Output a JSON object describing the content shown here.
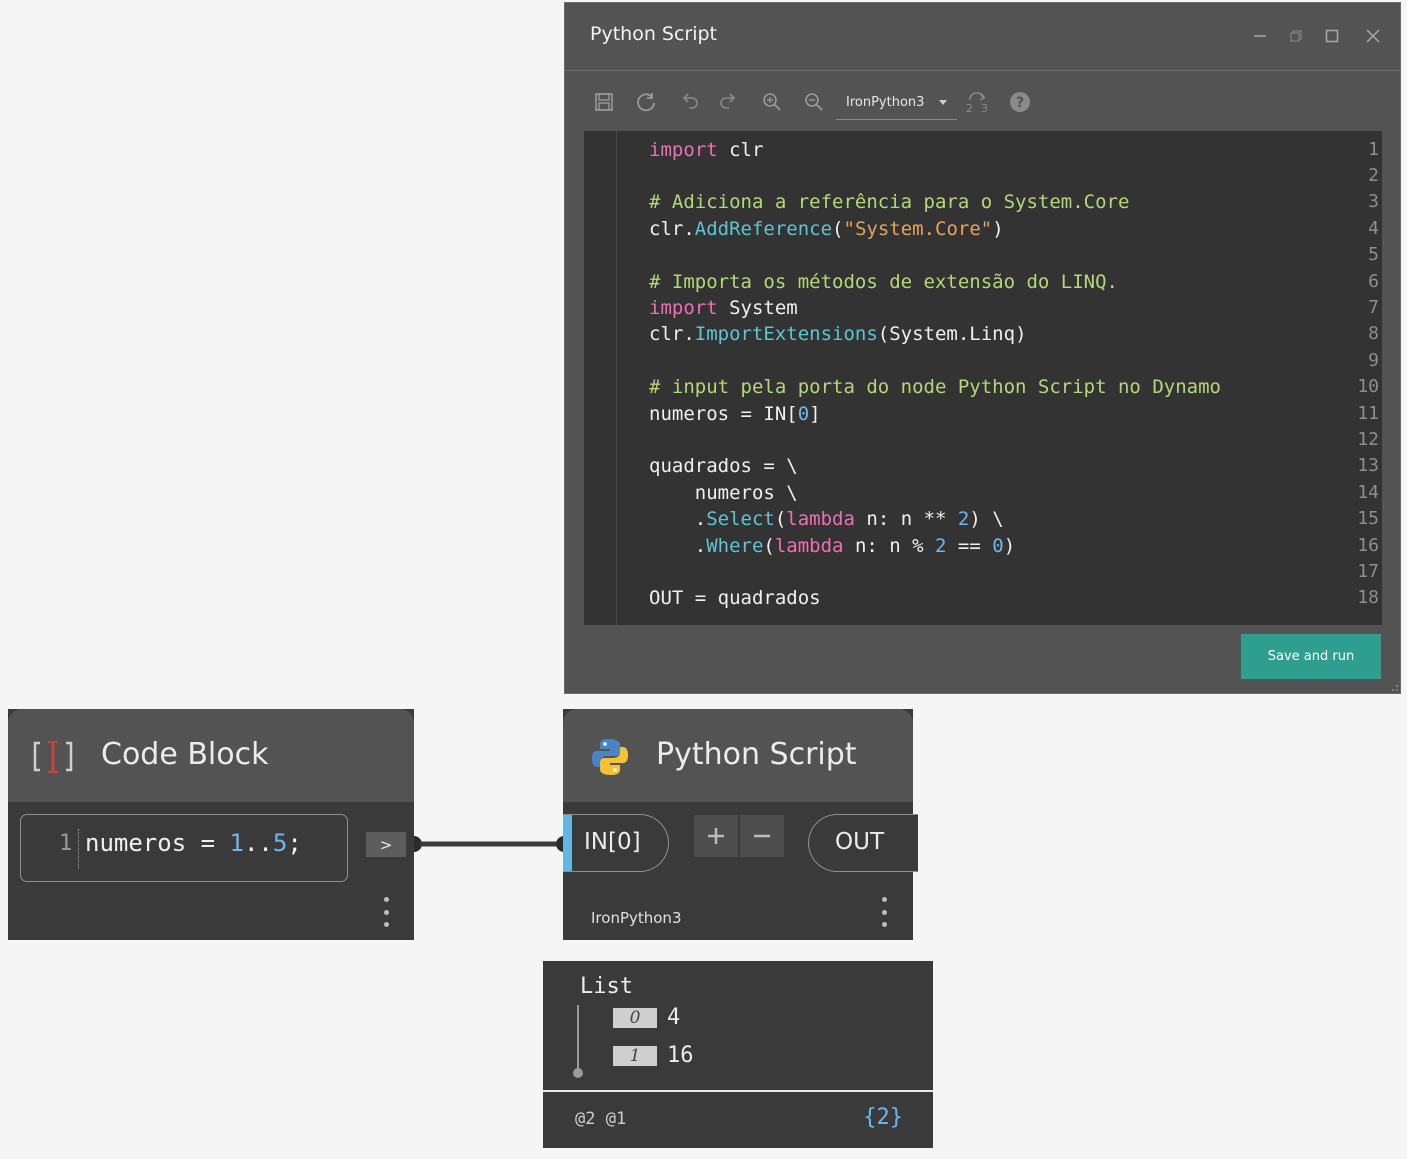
{
  "editor": {
    "title": "Python Script",
    "window_controls": [
      "minimize-icon",
      "restore-icon",
      "maximize-icon",
      "close-icon"
    ],
    "toolbar": {
      "icons": [
        "save-icon",
        "revert-icon",
        "undo-icon",
        "redo-icon",
        "zoom-in-icon",
        "zoom-out-icon",
        "migration-assistant-icon",
        "help-icon"
      ],
      "engine": "IronPython3"
    },
    "line_numbers": [
      "1",
      "2",
      "3",
      "4",
      "5",
      "6",
      "7",
      "8",
      "9",
      "10",
      "11",
      "12",
      "13",
      "14",
      "15",
      "16",
      "17",
      "18"
    ],
    "code_lines": [
      "import clr",
      "",
      "# Adiciona a referência para o System.Core",
      "clr.AddReference(\"System.Core\")",
      "",
      "# Importa os métodos de extensão do LINQ.",
      "import System",
      "clr.ImportExtensions(System.Linq)",
      "",
      "# input pela porta do node Python Script no Dynamo",
      "numeros = IN[0]",
      "",
      "quadrados = \\",
      "    numeros \\",
      "    .Select(lambda n: n ** 2) \\",
      "    .Where(lambda n: n % 2 == 0)",
      "",
      "OUT = quadrados"
    ],
    "save_run_label": "Save and run",
    "colors": {
      "keyword": "#ee6fb3",
      "comment": "#b5d778",
      "function": "#5cc6d3",
      "string": "#e7a25b",
      "number": "#6cb6f2",
      "button": "#2e9e8e"
    }
  },
  "code_block_node": {
    "title": "Code Block",
    "icon": "code-block-icon",
    "line_number": "1",
    "code": "numeros = 1..5;",
    "output_port": ">"
  },
  "python_node": {
    "title": "Python Script",
    "icon": "python-logo-icon",
    "input_port": "IN[0]",
    "add_port": "+",
    "remove_port": "−",
    "output_port": "OUT",
    "engine": "IronPython3",
    "port_color": "#63b6e0"
  },
  "preview": {
    "header": "List",
    "items": [
      {
        "index": "0",
        "value": "4"
      },
      {
        "index": "1",
        "value": "16"
      }
    ],
    "levels": "@2 @1",
    "count": "{2}"
  }
}
